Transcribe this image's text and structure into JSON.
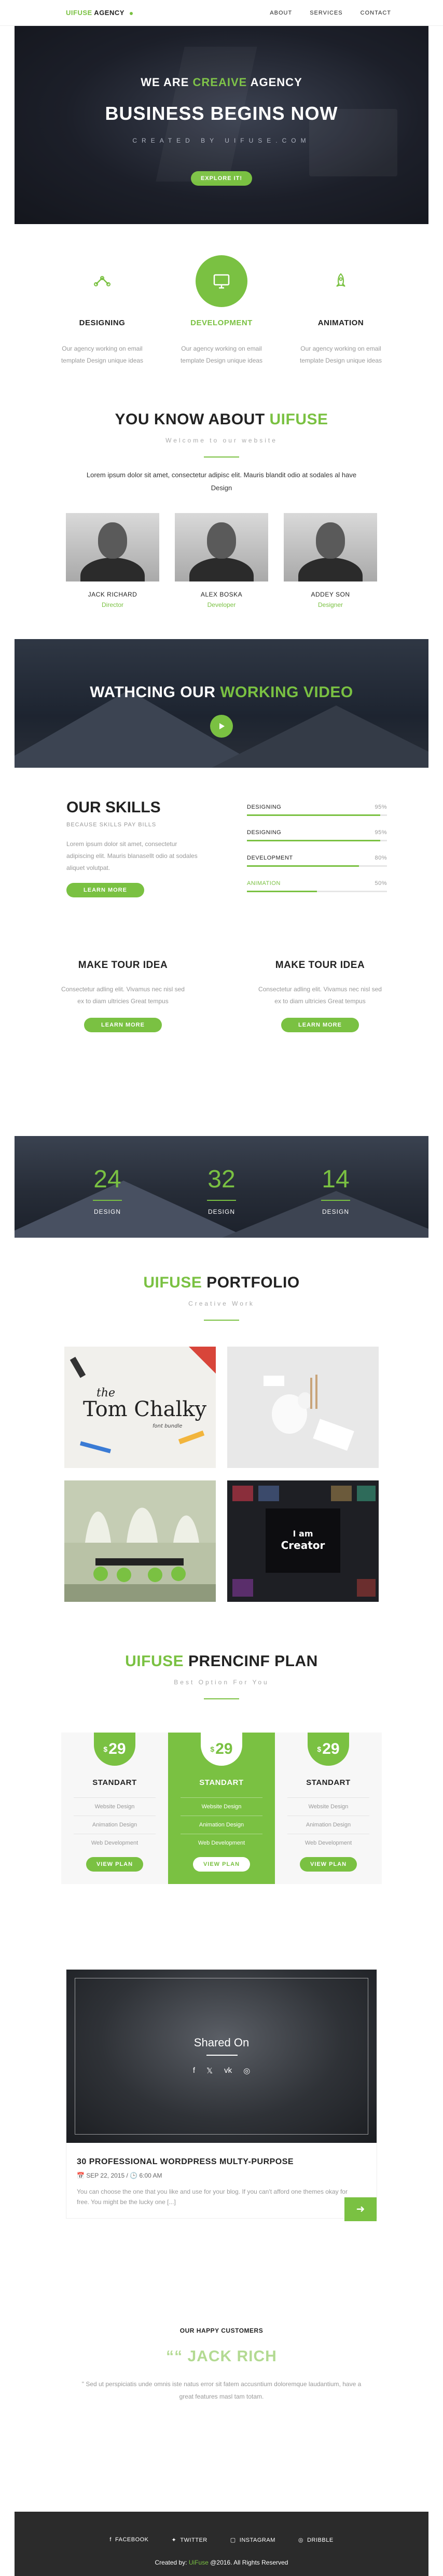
{
  "nav": {
    "brand_accent": "UIFUSE",
    "brand_rest": " AGENCY",
    "items": [
      "ABOUT",
      "SERVICES",
      "CONTACT"
    ]
  },
  "hero": {
    "pre_white": "WE ARE ",
    "pre_green": "CREAIVE",
    "pre_white2": " AGENCY",
    "title": "BUSINESS BEGINS NOW",
    "subtitle": "CREATED BY UIFUSE.COM",
    "button": "EXPLORE IT!"
  },
  "features": [
    {
      "icon": "gear-icon",
      "title": "DESIGNING",
      "text": "Our agency working on email template Design unique ideas",
      "active": false
    },
    {
      "icon": "monitor-icon",
      "title": "DEVELOPMENT",
      "text": "Our agency working on email template Design unique ideas",
      "active": true
    },
    {
      "icon": "rocket-icon",
      "title": "ANIMATION",
      "text": "Our agency working on email template Design unique ideas",
      "active": false
    }
  ],
  "about": {
    "title_plain": "YOU KNOW ABOUT ",
    "title_green": "UIFUSE",
    "subtitle": "Welcome to our website",
    "lead": "Lorem ipsum dolor sit amet, consectetur adipisc elit. Mauris blandit odio at sodales al have Design",
    "team": [
      {
        "name": "JACK RICHARD",
        "role": "Director"
      },
      {
        "name": "ALEX BOSKA",
        "role": "Developer"
      },
      {
        "name": "ADDEY SON",
        "role": "Designer"
      }
    ]
  },
  "video": {
    "title_plain": "WATHCING OUR ",
    "title_green": "WORKING VIDEO"
  },
  "skills": {
    "title": "OUR SKILLS",
    "tag": "BECAUSE SKILLS PAY BILLS",
    "text": "Lorem ipsum dolor sit amet, consectetur adipiscing elit. Mauris blanasellt odio at sodales aliquet volutpat.",
    "button": "LEARN MORE",
    "bars": [
      {
        "label": "DESIGNING",
        "value": 95,
        "pct": "95%",
        "active": false
      },
      {
        "label": "DESIGNING",
        "value": 95,
        "pct": "95%",
        "active": false
      },
      {
        "label": "DEVELOPMENT",
        "value": 80,
        "pct": "80%",
        "active": false
      },
      {
        "label": "ANIMATION",
        "value": 50,
        "pct": "50%",
        "active": true
      }
    ]
  },
  "tour": [
    {
      "title": "MAKE TOUR IDEA",
      "text": "Consectetur adling elit. Vivamus nec nisl sed ex to diam ultricies Great tempus",
      "button": "LEARN MORE"
    },
    {
      "title": "MAKE TOUR IDEA",
      "text": "Consectetur adling elit. Vivamus nec nisl sed ex to diam ultricies Great tempus",
      "button": "LEARN MORE"
    }
  ],
  "counters": [
    {
      "num": "24",
      "label": "DESIGN"
    },
    {
      "num": "32",
      "label": "DESIGN"
    },
    {
      "num": "14",
      "label": "DESIGN"
    }
  ],
  "portfolio": {
    "title_green": "UIFUSE",
    "title_plain": " PORTFOLIO",
    "subtitle": "Creative Work",
    "tile1_word1": "the",
    "tile1_word2": "Tom Chalky",
    "tile1_word3": "font bundle",
    "tile4_word1": "I am",
    "tile4_word2": "Creator"
  },
  "pricing": {
    "title_green": "UIFUSE",
    "title_plain": " PRENCINF PLAN",
    "subtitle": "Best Option For You",
    "plans": [
      {
        "currency": "$",
        "price": "29",
        "name": "STANDART",
        "features": [
          "Website Design",
          "Animation Design",
          "Web Development"
        ],
        "button": "VIEW PLAN"
      },
      {
        "currency": "$",
        "price": "29",
        "name": "STANDART",
        "features": [
          "Website Design",
          "Animation Design",
          "Web Development"
        ],
        "button": "VIEW PLAN"
      },
      {
        "currency": "$",
        "price": "29",
        "name": "STANDART",
        "features": [
          "Website Design",
          "Animation Design",
          "Web Development"
        ],
        "button": "VIEW PLAN"
      }
    ]
  },
  "blog": {
    "overlay": "Shared On",
    "title": "30 PROFESSIONAL WORDPRESS MULTY-PURPOSE",
    "date": "SEP 22, 2015",
    "time": "6:00 AM",
    "excerpt": "You can choose the one that you like and use for your blog. If you can't afford one themes okay for free. You might be the lucky one [...]"
  },
  "testimonial": {
    "kicker": "OUR HAPPY CUSTOMERS",
    "name": "JACK RICH",
    "quote": "\" Sed ut perspiciatis unde omnis iste natus error sit fatem accusntium doloremque laudantium, have a great features masl tam totam."
  },
  "footer": {
    "social": [
      "FACEBOOK",
      "TWITTER",
      "INSTAGRAM",
      "DRIBBLE"
    ],
    "copy_pre": "Created by: ",
    "copy_brand": "UiFuse",
    "copy_post": " @2016. All Rights Reserved"
  },
  "colors": {
    "accent": "#7ac142",
    "dark": "#1c1f29",
    "footer": "#2b2b2b"
  }
}
